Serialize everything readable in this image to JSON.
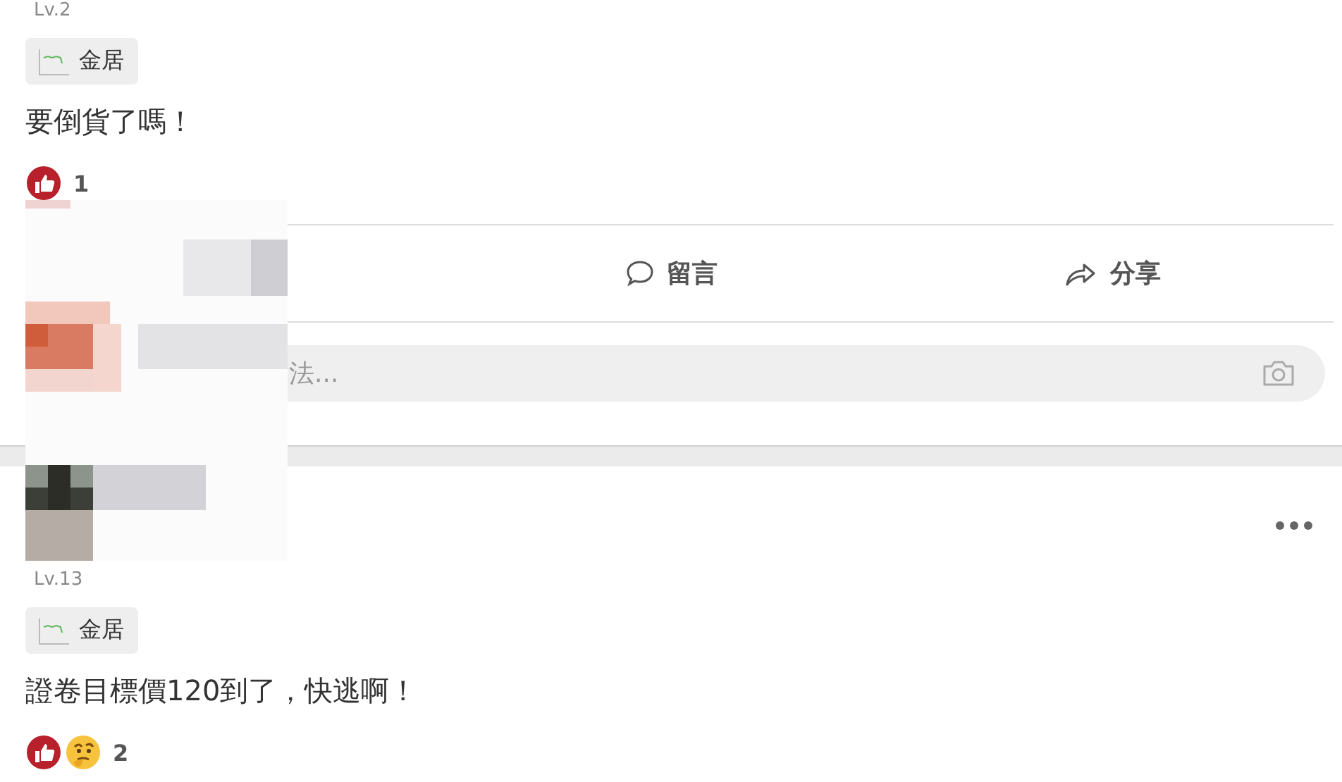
{
  "posts": [
    {
      "level": "Lv.2",
      "tag": "金居",
      "text": "要倒貨了嗎！",
      "reactions": [
        {
          "kind": "like"
        }
      ],
      "reaction_count": "1",
      "actions": [
        {
          "kind": "comment",
          "label": "留言"
        },
        {
          "kind": "share",
          "label": "分享"
        }
      ],
      "comment_field": {
        "placeholder": "法..."
      }
    },
    {
      "level": "Lv.13",
      "tag": "金居",
      "text": "證卷目標價120到了，快逃啊！",
      "reactions": [
        {
          "kind": "like"
        },
        {
          "kind": "think"
        }
      ],
      "reaction_count": "2"
    }
  ]
}
